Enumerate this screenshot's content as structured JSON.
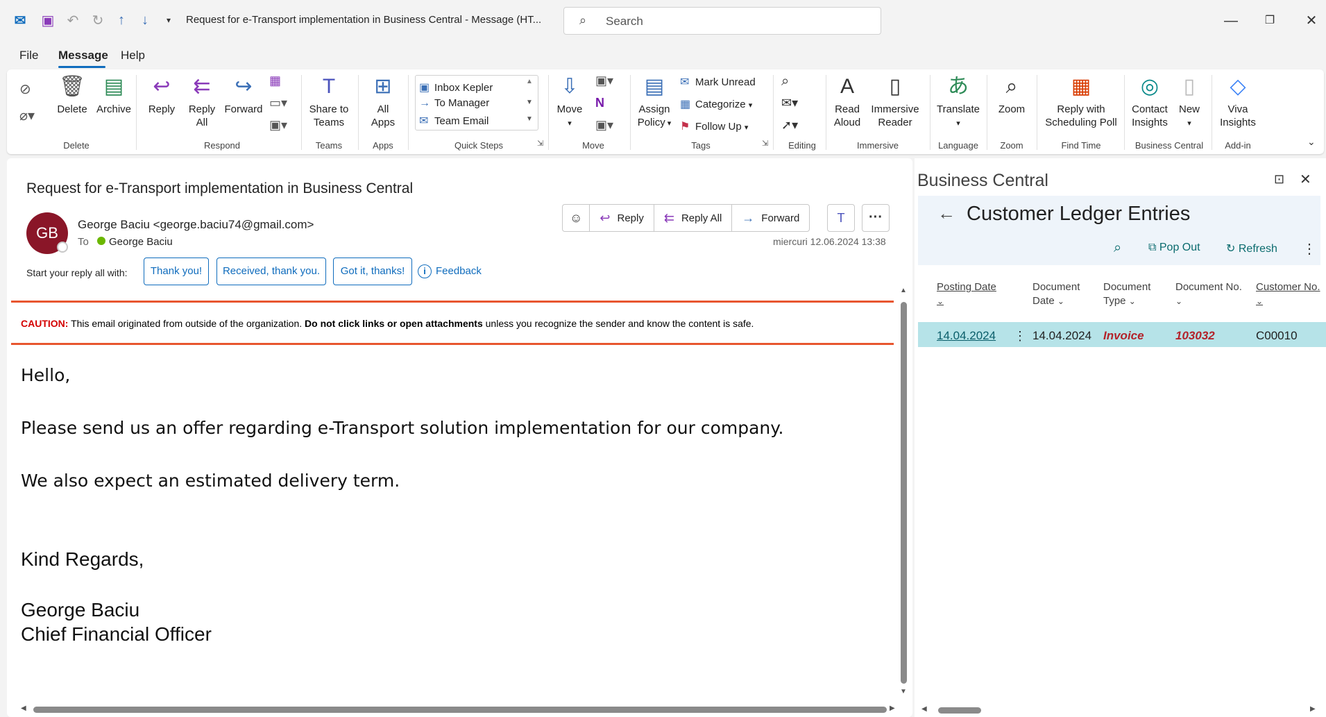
{
  "titlebar": {
    "title": "Request for e-Transport implementation in Business Central  -  Message (HT...",
    "search_placeholder": "Search"
  },
  "menu": {
    "file": "File",
    "message": "Message",
    "help": "Help"
  },
  "ribbon": {
    "delete": "Delete",
    "archive": "Archive",
    "reply": "Reply",
    "reply_all_1": "Reply",
    "reply_all_2": "All",
    "forward": "Forward",
    "share_teams_1": "Share to",
    "share_teams_2": "Teams",
    "all_apps_1": "All",
    "all_apps_2": "Apps",
    "quick_steps": [
      "Inbox Kepler",
      "To Manager",
      "Team Email"
    ],
    "move": "Move",
    "assign_policy_1": "Assign",
    "assign_policy_2": "Policy",
    "mark_unread": "Mark Unread",
    "categorize": "Categorize",
    "follow_up": "Follow Up",
    "read_aloud_1": "Read",
    "read_aloud_2": "Aloud",
    "immersive_reader_1": "Immersive",
    "immersive_reader_2": "Reader",
    "translate": "Translate",
    "zoom": "Zoom",
    "reply_poll_1": "Reply with",
    "reply_poll_2": "Scheduling Poll",
    "contact_insights_1": "Contact",
    "contact_insights_2": "Insights",
    "new": "New",
    "viva_insights_1": "Viva",
    "viva_insights_2": "Insights",
    "groups": {
      "delete": "Delete",
      "respond": "Respond",
      "teams": "Teams",
      "apps": "Apps",
      "quick_steps": "Quick Steps",
      "move": "Move",
      "tags": "Tags",
      "editing": "Editing",
      "immersive": "Immersive",
      "language": "Language",
      "zoom": "Zoom",
      "find_time": "Find Time",
      "business_central": "Business Central",
      "add_in": "Add-in"
    }
  },
  "message": {
    "subject": "Request for e-Transport implementation in Business Central",
    "avatar_initials": "GB",
    "sender": "George Baciu <george.baciu74@gmail.com>",
    "to_label": "To",
    "to_name": "George Baciu",
    "date": "miercuri 12.06.2024 13:38",
    "actions": {
      "reply": "Reply",
      "reply_all": "Reply All",
      "forward": "Forward"
    },
    "quick_reply_label": "Start your reply all with:",
    "quick_replies": [
      "Thank you!",
      "Received, thank you.",
      "Got it, thanks!"
    ],
    "feedback": "Feedback",
    "caution": {
      "label": "CAUTION:",
      "text1": " This email originated from outside of the organization. ",
      "bold": "Do not click links or open attachments",
      "text2": " unless you recognize the sender and know the content is safe."
    },
    "body": {
      "greeting": "Hello,",
      "line1": "Please send us an offer regarding e-Transport solution implementation for our company.",
      "line2": "We also expect an estimated delivery term.",
      "closing": "Kind Regards,",
      "sig_name": "George Baciu",
      "sig_title": "Chief Financial Officer"
    }
  },
  "business_central": {
    "pane_title": "Business Central",
    "page_title": "Customer Ledger Entries",
    "actions": {
      "pop_out": "Pop Out",
      "refresh": "Refresh"
    },
    "columns": {
      "posting_date": "Posting Date",
      "document_date_1": "Document",
      "document_date_2": "Date",
      "document_type_1": "Document",
      "document_type_2": "Type",
      "document_no": "Document No.",
      "customer_no": "Customer No."
    },
    "rows": [
      {
        "posting_date": "14.04.2024",
        "document_date": "14.04.2024",
        "document_type": "Invoice",
        "document_no": "103032",
        "customer_no": "C00010"
      }
    ]
  }
}
